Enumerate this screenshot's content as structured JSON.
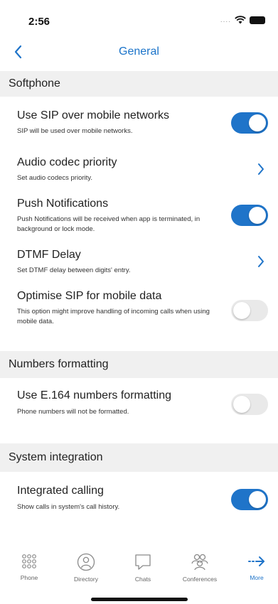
{
  "status": {
    "time": "2:56",
    "signal": "....",
    "wifi_icon": "wifi-icon",
    "battery_icon": "battery-icon"
  },
  "nav": {
    "title": "General",
    "back_icon": "chevron-left-icon"
  },
  "sections": {
    "softphone": "Softphone",
    "numbers": "Numbers formatting",
    "system": "System integration"
  },
  "settings": {
    "sip_mobile": {
      "title": "Use SIP over mobile networks",
      "subtitle": "SIP will be used over mobile networks.",
      "enabled": true
    },
    "audio_codec": {
      "title": "Audio codec priority",
      "subtitle": "Set audio codecs priority."
    },
    "push": {
      "title": "Push Notifications",
      "subtitle": "Push Notifications will be received when app is terminated, in background or lock mode.",
      "enabled": true
    },
    "dtmf": {
      "title": "DTMF Delay",
      "subtitle": "Set DTMF delay between digits' entry."
    },
    "optimise_sip": {
      "title": "Optimise SIP for mobile data",
      "subtitle": "This option might improve handling of incoming calls when using mobile data.",
      "enabled": false
    },
    "e164": {
      "title": "Use E.164 numbers formatting",
      "subtitle": "Phone numbers will not be formatted.",
      "enabled": false
    },
    "integrated": {
      "title": "Integrated calling",
      "subtitle": "Show calls in system's call history.",
      "enabled": true
    }
  },
  "tabs": [
    {
      "label": "Phone",
      "icon": "dialpad-icon",
      "active": false
    },
    {
      "label": "Directory",
      "icon": "person-icon",
      "active": false
    },
    {
      "label": "Chats",
      "icon": "chat-bubble-icon",
      "active": false
    },
    {
      "label": "Conferences",
      "icon": "group-icon",
      "active": false
    },
    {
      "label": "More",
      "icon": "arrow-right-icon",
      "active": true
    }
  ],
  "colors": {
    "accent": "#1f74c9",
    "section_bg": "#f0f0f0",
    "toggle_off": "#e9e9e9"
  }
}
